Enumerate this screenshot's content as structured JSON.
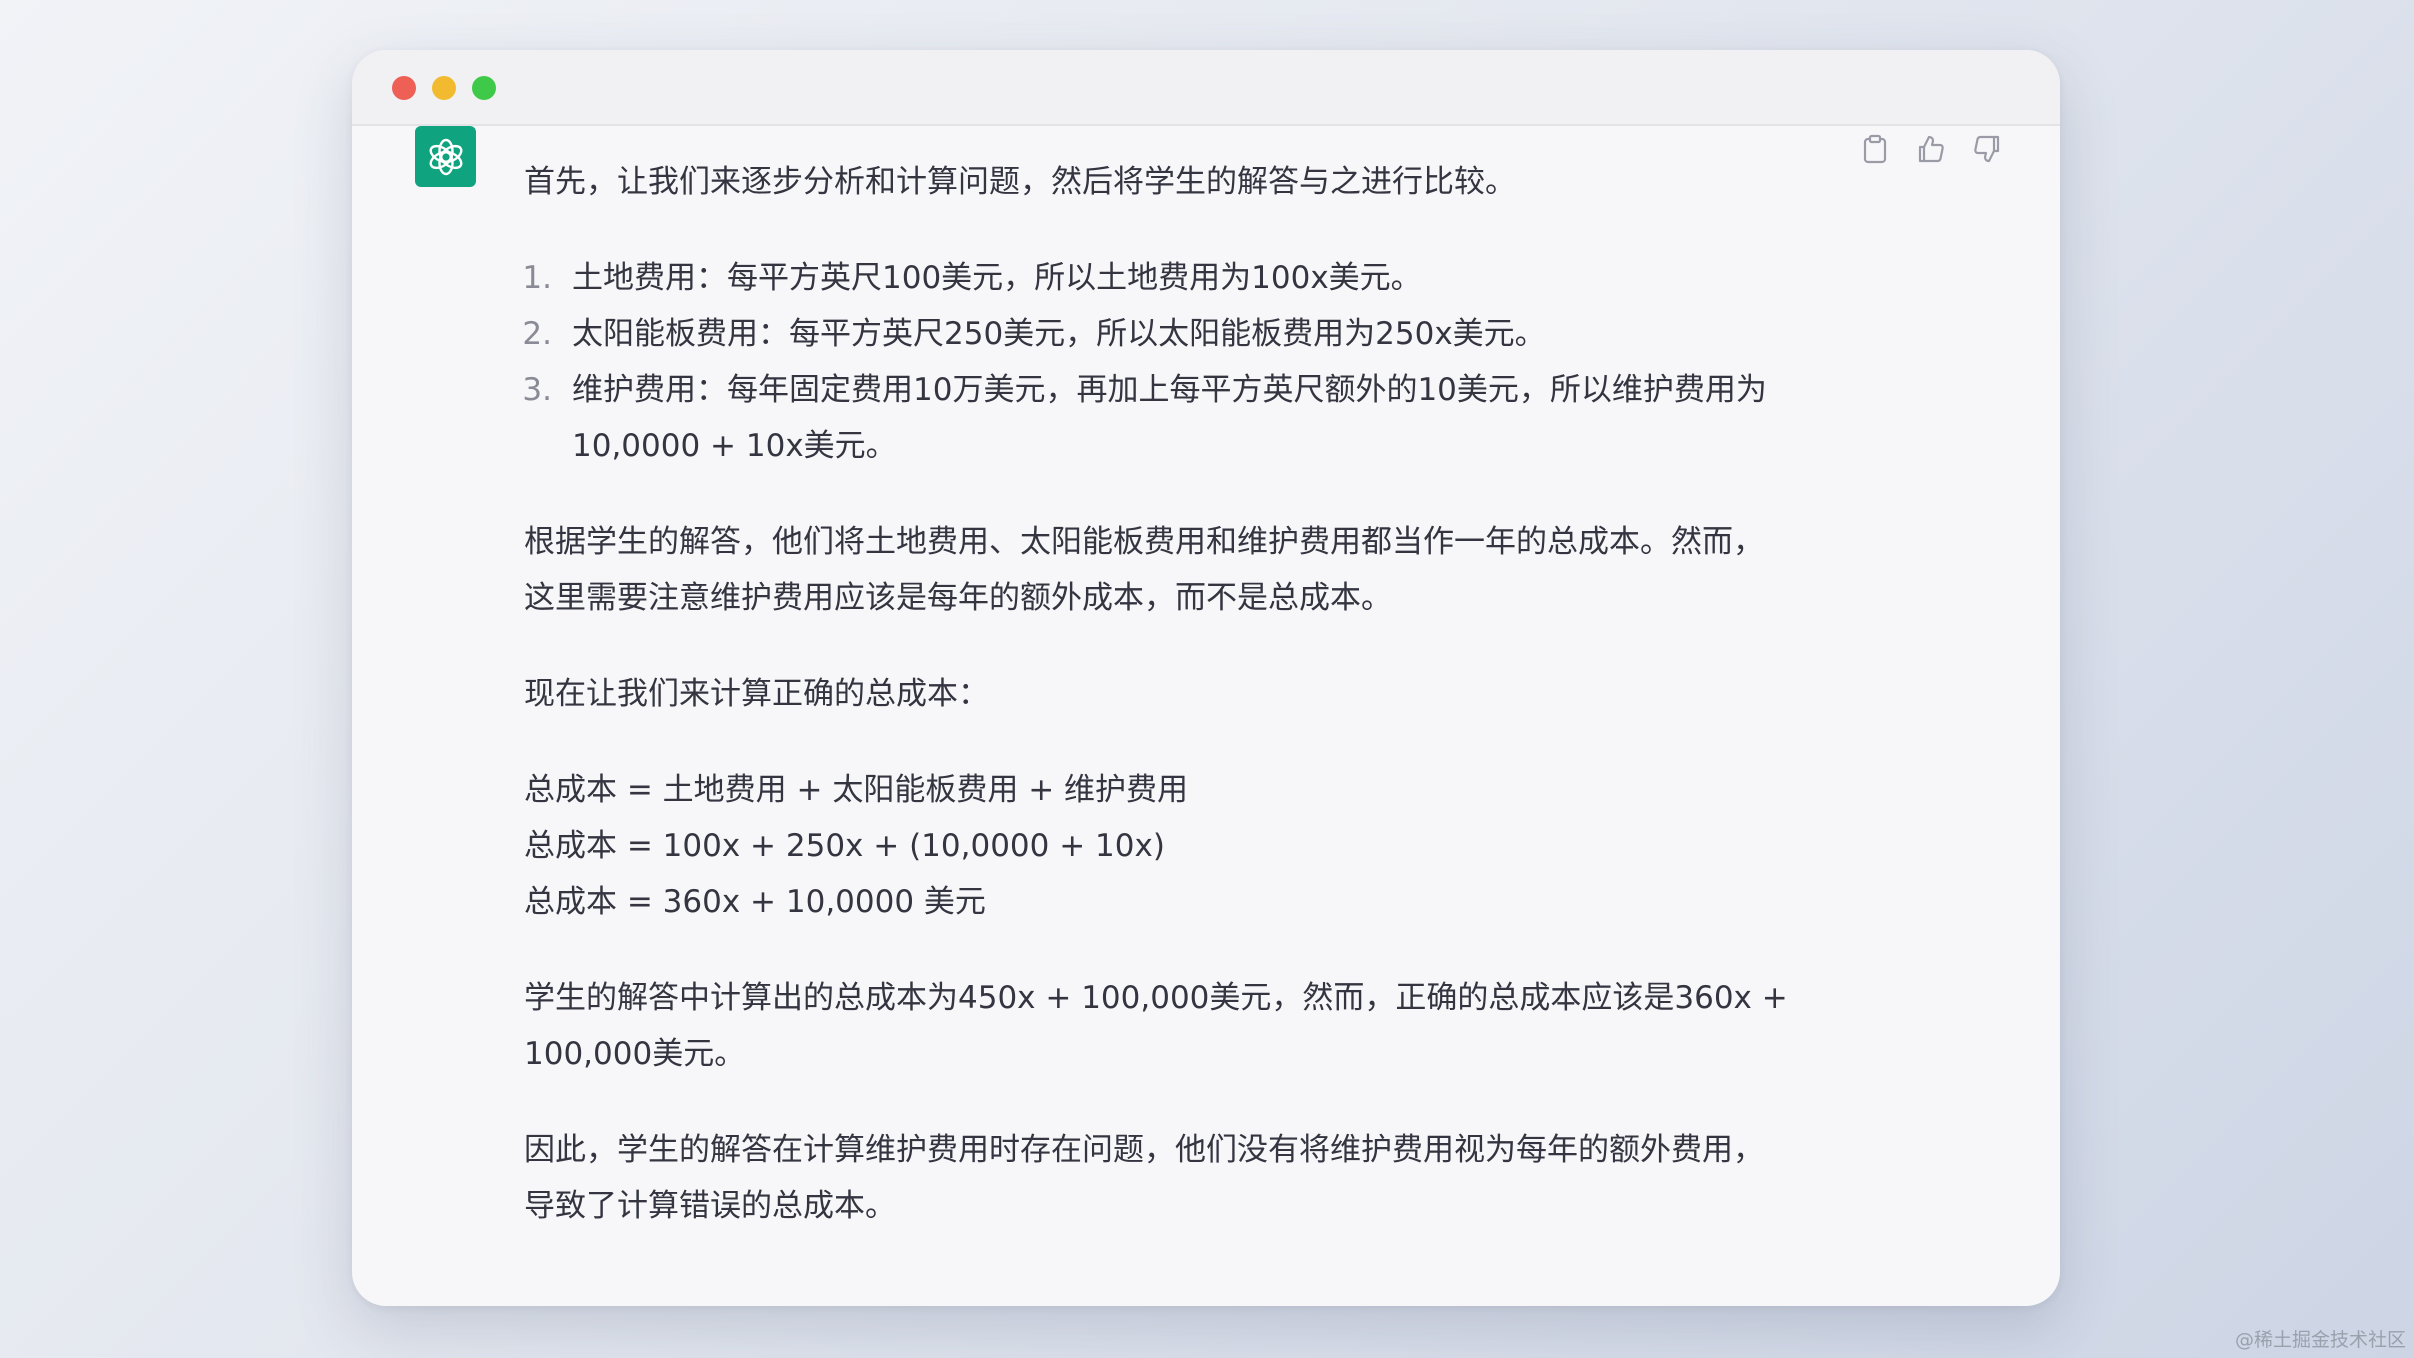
{
  "window": {
    "controls": [
      "close",
      "minimize",
      "maximize"
    ]
  },
  "message": {
    "intro": "首先，让我们来逐步分析和计算问题，然后将学生的解答与之进行比较。",
    "list": [
      {
        "num": "1.",
        "text": "土地费用：每平方英尺100美元，所以土地费用为100x美元。"
      },
      {
        "num": "2.",
        "text": "太阳能板费用：每平方英尺250美元，所以太阳能板费用为250x美元。"
      },
      {
        "num": "3.",
        "text": "维护费用：每年固定费用10万美元，再加上每平方英尺额外的10美元，所以维护费用为",
        "text2": "10,0000 + 10x美元。"
      }
    ],
    "para1_line1": "根据学生的解答，他们将土地费用、太阳能板费用和维护费用都当作一年的总成本。然而，",
    "para1_line2": "这里需要注意维护费用应该是每年的额外成本，而不是总成本。",
    "para2": "现在让我们来计算正确的总成本：",
    "formula1": "总成本 = 土地费用 + 太阳能板费用 + 维护费用",
    "formula2": "总成本 = 100x + 250x + (10,0000 + 10x)",
    "formula3": "总成本 = 360x + 10,0000 美元",
    "para3_line1": "学生的解答中计算出的总成本为450x + 100,000美元，然而，正确的总成本应该是360x +",
    "para3_line2": "100,000美元。",
    "para4_line1": "因此，学生的解答在计算维护费用时存在问题，他们没有将维护费用视为每年的额外费用，",
    "para4_line2": "导致了计算错误的总成本。"
  },
  "icons": {
    "avatar": "openai-logo-icon",
    "copy": "clipboard-icon",
    "like": "thumbs-up-icon",
    "dislike": "thumbs-down-icon"
  },
  "colors": {
    "avatar_bg": "#10a37f",
    "text": "#343541"
  },
  "watermark": "@稀土掘金技术社区"
}
